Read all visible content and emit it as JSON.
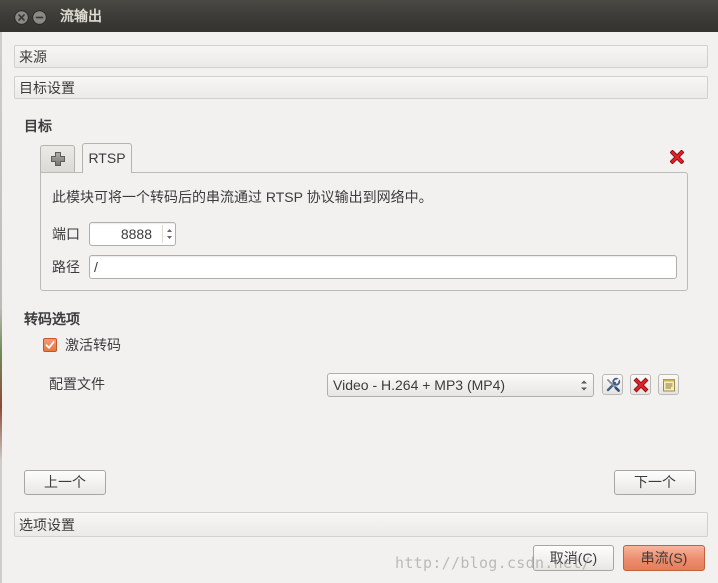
{
  "window": {
    "title": "流输出"
  },
  "sections": {
    "source": "来源",
    "destination_setup": "目标设置",
    "option_setup": "选项设置"
  },
  "destination": {
    "heading": "目标",
    "tabs": [
      {
        "label": "RTSP",
        "selected": true
      }
    ],
    "description": "此模块可将一个转码后的串流通过 RTSP 协议输出到网络中。",
    "port": {
      "label": "端口",
      "value": "8888"
    },
    "path": {
      "label": "路径",
      "value": "/"
    }
  },
  "transcode": {
    "heading": "转码选项",
    "activate": {
      "label": "激活转码",
      "checked": true
    },
    "profile": {
      "label": "配置文件",
      "selected": "Video - H.264 + MP3 (MP4)"
    }
  },
  "navigation": {
    "previous": "上一个",
    "next": "下一个"
  },
  "footer": {
    "cancel": "取消(C)",
    "stream": "串流(S)"
  },
  "watermark": "http://blog.csdn.net/",
  "icons": {
    "close": "close-icon",
    "minimize": "minimize-icon",
    "add_destination": "plus-icon",
    "remove_destination": "red-x-icon",
    "edit_profile": "wrench-icon",
    "delete_profile": "red-x-icon",
    "new_profile": "notepad-icon",
    "spin_arrows": "up-down-arrows-icon",
    "combo_arrows": "up-down-arrows-icon",
    "check": "checkmark-icon"
  },
  "colors": {
    "titlebar": "#3c3b37",
    "window_bg": "#f2f1f0",
    "accent": "#e9773f",
    "delete": "#d1131b"
  }
}
